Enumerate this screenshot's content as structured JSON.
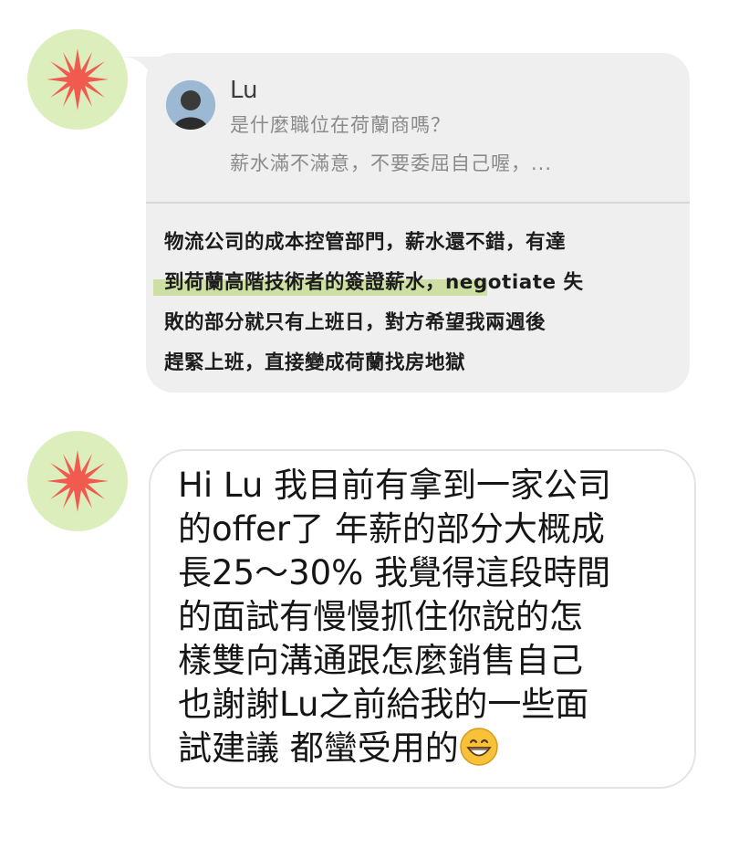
{
  "conversation": {
    "message1": {
      "quoted": {
        "sender": "Lu",
        "lines": [
          "是什麼職位在荷蘭商嗎？",
          "薪水滿不滿意，不要委屈自己喔，..."
        ]
      },
      "reply_lines": [
        "物流公司的成本控管部門，薪水還不錯，有達",
        "到荷蘭高階技術者的簽證薪水，negotiate 失",
        "敗的部分就只有上班日，對方希望我兩週後",
        "趕緊上班，直接變成荷蘭找房地獄"
      ]
    },
    "message2": {
      "lines": [
        "Hi Lu 我目前有拿到一家公司",
        "的offer了 年薪的部分大概成",
        "長25～30% 我覺得這段時間",
        "的面試有慢慢抓住你說的怎",
        "樣雙向溝通跟怎麼銷售自己",
        "也謝謝Lu之前給我的一些面",
        "試建議 都蠻受用的"
      ],
      "trailing_emoji": "grinning-face-emoji"
    }
  },
  "colors": {
    "avatar_bg": "#ddeebd",
    "starburst": "#f05a4f",
    "card_bg": "#efeff0",
    "highlight": "#c3d98a"
  }
}
